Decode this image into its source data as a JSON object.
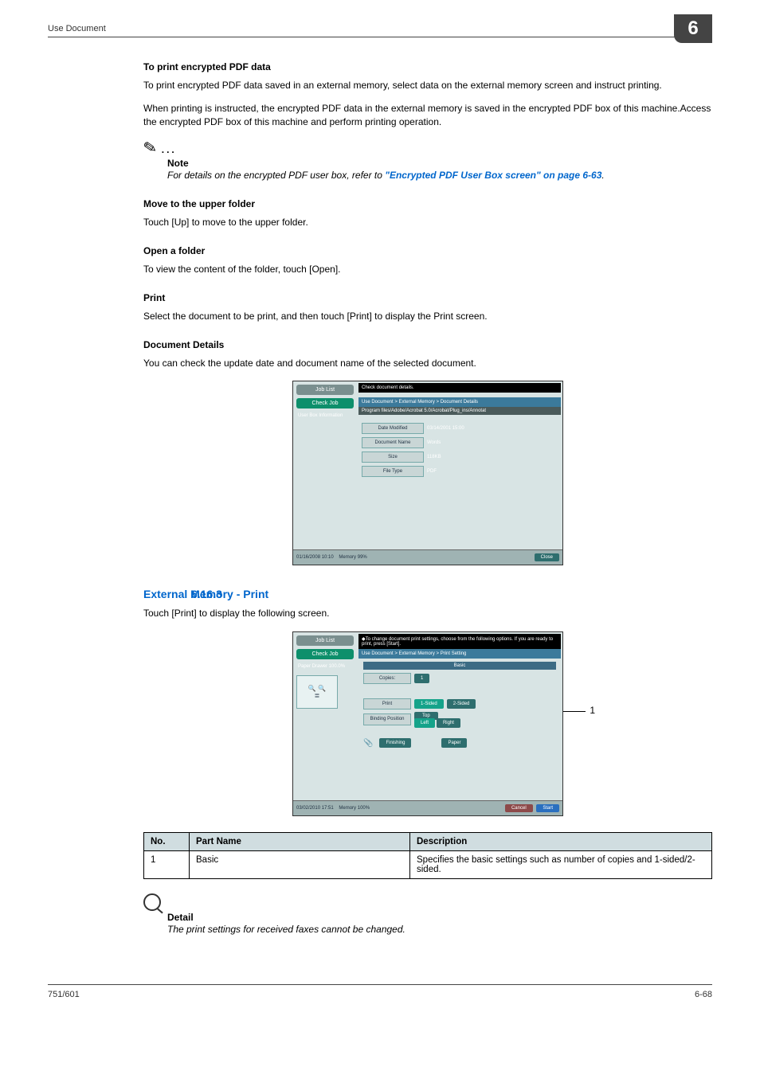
{
  "page": {
    "running_head": "Use Document",
    "corner_number": "6",
    "footer_left": "751/601",
    "footer_right": "6-68"
  },
  "sec_encrypted": {
    "title": "To print encrypted PDF data",
    "p1": "To print encrypted PDF data saved in an external memory, select data on the external memory screen and instruct printing.",
    "p2": "When printing is instructed, the encrypted PDF data in the external memory is saved in the encrypted PDF box of this machine.Access the encrypted PDF box of this machine and perform printing operation.",
    "note_label": "Note",
    "note_text_pre": "For details on the encrypted PDF user box, refer to ",
    "note_link": "\"Encrypted PDF User Box screen\" on page 6-63",
    "note_text_post": "."
  },
  "sec_move": {
    "title": "Move to the upper folder",
    "p": "Touch [Up] to move to the upper folder."
  },
  "sec_open": {
    "title": "Open a folder",
    "p": "To view the content of the folder, touch [Open]."
  },
  "sec_print": {
    "title": "Print",
    "p": "Select the document to be print, and then touch [Print] to display the Print screen."
  },
  "sec_details": {
    "title": "Document Details",
    "p": "You can check the update date and document name of the selected document."
  },
  "panel1": {
    "tabJobList": "Job List",
    "tabCheckJob": "Check Job",
    "sidebar": "User Box Information",
    "topbar": "Check document details.",
    "breadcrumb": "Use Document > External Memory > Document Details",
    "path": "Program files/Adobe/Acrobat 5.0/Acrobat/Plug_ins/Annotat",
    "rows": {
      "dateLabel": "Date Modified",
      "dateVal": "03/14/2001 15:00",
      "nameLabel": "Document Name",
      "nameVal": "Words",
      "sizeLabel": "Size",
      "sizeVal": "118KB",
      "typeLabel": "File Type",
      "typeVal": "PDF"
    },
    "footer": {
      "stamp": "01/16/2008   10:10",
      "memory": "Memory      99%",
      "close": "Close"
    }
  },
  "sec_6_16_3": {
    "num": "6.16.3",
    "title": "External Memory - Print",
    "p": "Touch [Print] to display the following screen."
  },
  "panel2": {
    "tabJobList": "Job List",
    "tabCheckJob": "Check Job",
    "sidebar": "Paper Drawer   100.0%",
    "topbar": "◆To change document print settings, choose from the following options. If you are ready to print, press [Start].",
    "breadcrumb": "Use Document > External Memory > Print Setting",
    "tab": "Basic",
    "copiesLabel": "Copies:",
    "copiesVal": "1",
    "printLabel": "Print",
    "opt1sided": "1-Sided",
    "opt2sided": "2-Sided",
    "bindLabel": "Binding Position",
    "bindTop": "Top",
    "bindLeft": "Left",
    "bindRight": "Right",
    "finishing": "Finishing",
    "paper": "Paper",
    "footer": {
      "stamp": "03/02/2010   17:51",
      "memory": "Memory      100%",
      "cancel": "Cancel",
      "start": "Start"
    },
    "callout": "1"
  },
  "parts": {
    "header": {
      "no": "No.",
      "name": "Part Name",
      "desc": "Description"
    },
    "rows": [
      {
        "no": "1",
        "name": "Basic",
        "desc": "Specifies the basic settings such as number of copies and 1-sided/2-sided."
      }
    ]
  },
  "detail": {
    "label": "Detail",
    "text": "The print settings for received faxes cannot be changed."
  }
}
